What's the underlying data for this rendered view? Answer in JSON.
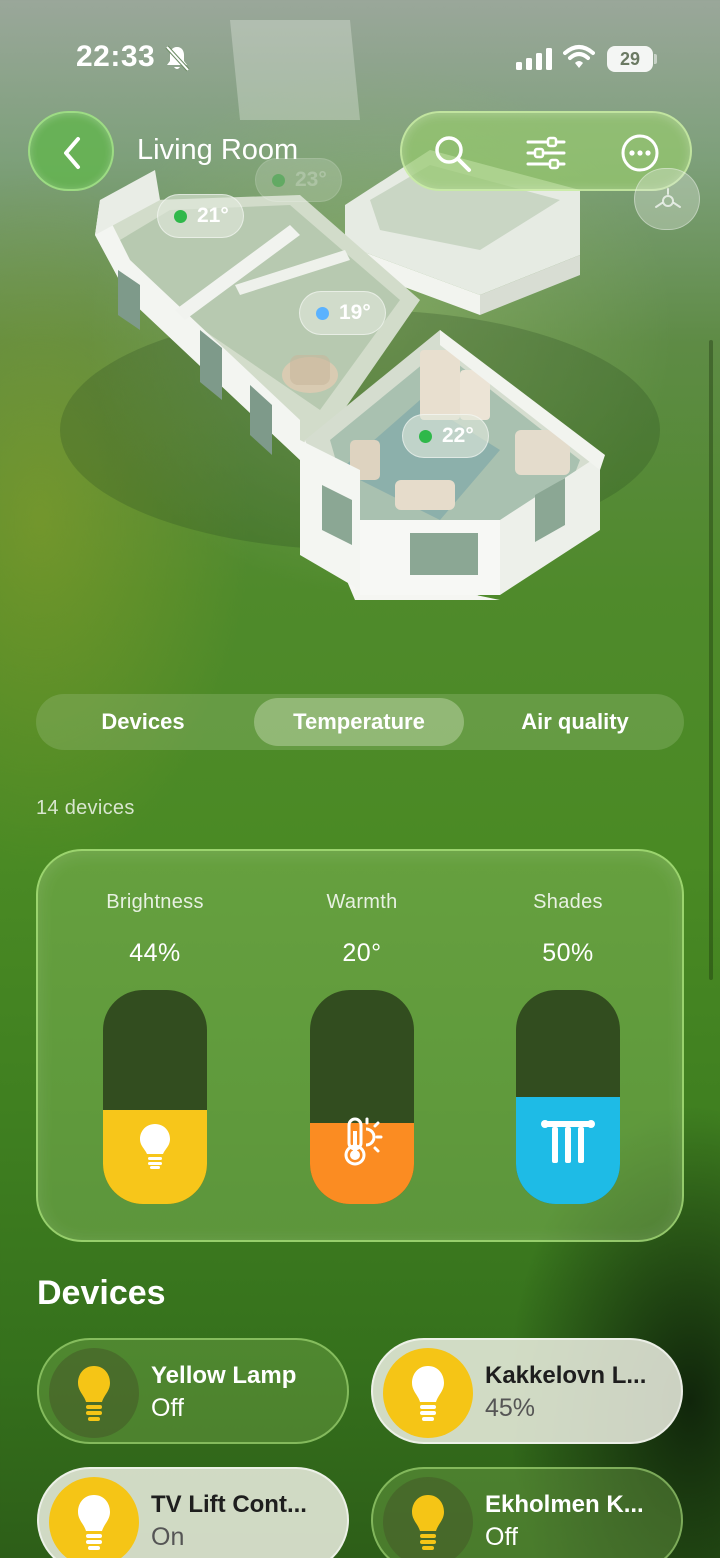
{
  "status_bar": {
    "time": "22:33",
    "battery": "29"
  },
  "header": {
    "title": "Living Room"
  },
  "floorplan": {
    "rooms": [
      {
        "temp": "23°",
        "dot_color": "#2fb84a"
      },
      {
        "temp": "21°",
        "dot_color": "#2fb84a"
      },
      {
        "temp": "19°",
        "dot_color": "#5ab2ff"
      },
      {
        "temp": "22°",
        "dot_color": "#2fb84a"
      }
    ]
  },
  "tabs": [
    {
      "label": "Devices",
      "active": false
    },
    {
      "label": "Temperature",
      "active": true
    },
    {
      "label": "Air quality",
      "active": false
    }
  ],
  "device_count": "14 devices",
  "controls": [
    {
      "label": "Brightness",
      "value": "44%",
      "level": 0.44,
      "color": "#f7c61a",
      "icon": "lightbulb-icon"
    },
    {
      "label": "Warmth",
      "value": "20°",
      "level": 0.38,
      "color": "#fb8c22",
      "icon": "thermometer-sun-icon"
    },
    {
      "label": "Shades",
      "value": "50%",
      "level": 0.5,
      "color": "#1ebbe6",
      "icon": "shades-icon"
    }
  ],
  "devices_section": {
    "title": "Devices",
    "items": [
      {
        "name": "Yellow Lamp",
        "state": "Off",
        "on": false,
        "icon": "lightbulb-icon"
      },
      {
        "name": "Kakkelovn L...",
        "state": "45%",
        "on": true,
        "icon": "lightbulb-icon"
      },
      {
        "name": "TV Lift Cont...",
        "state": "On",
        "on": true,
        "icon": "lightbulb-icon"
      },
      {
        "name": "Ekholmen K...",
        "state": "Off",
        "on": false,
        "icon": "lightbulb-icon"
      }
    ]
  },
  "colors": {
    "accent_green": "#4a8a24",
    "bulb_yellow": "#f5c516"
  }
}
